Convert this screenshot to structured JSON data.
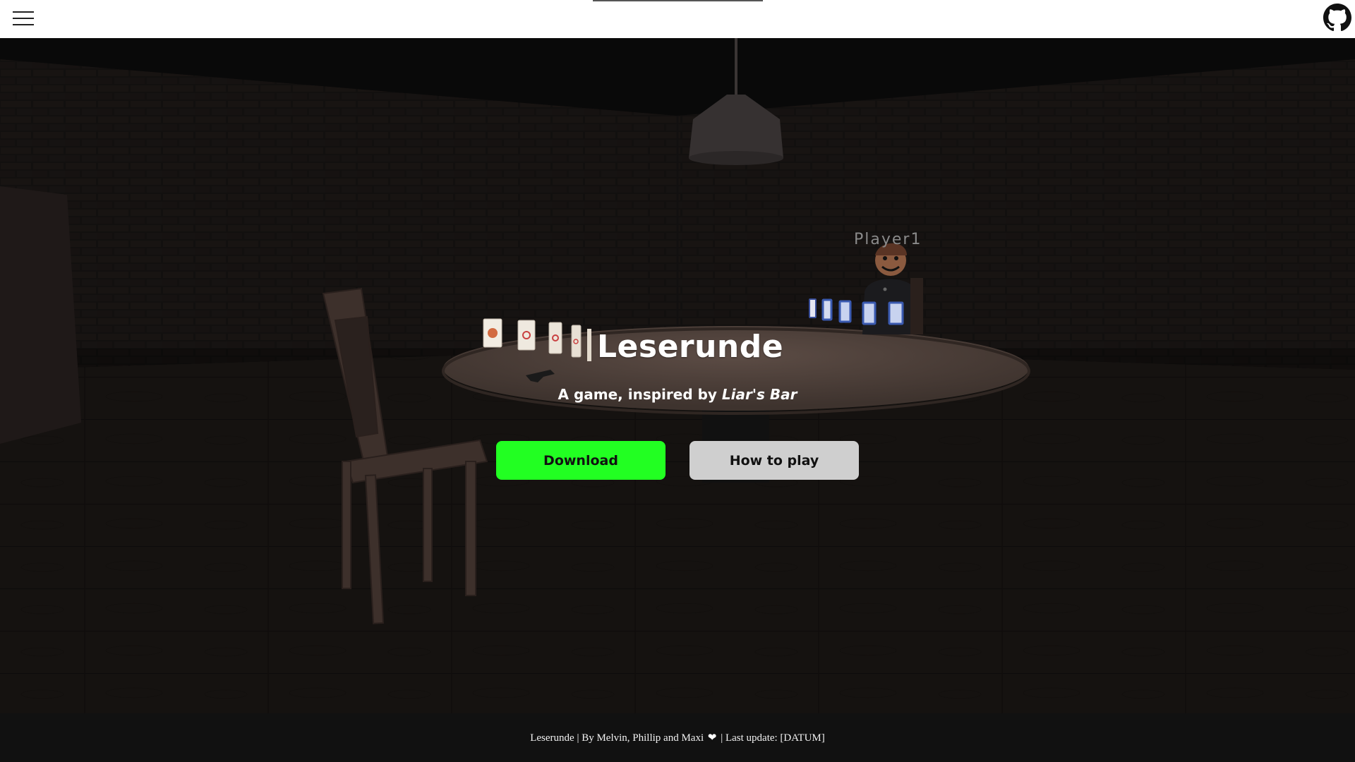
{
  "header": {
    "menu_icon": "hamburger-menu-icon",
    "github_icon": "github-icon"
  },
  "scene": {
    "player_label": "Player1"
  },
  "hero": {
    "title": "Leserunde",
    "subtitle_prefix": "A game, inspired by ",
    "subtitle_emphasis": "Liar's Bar",
    "download_label": "Download",
    "howto_label": "How to play"
  },
  "footer": {
    "text_before_heart": "Leserunde | By Melvin, Phillip and Maxi",
    "heart_icon": "heart-icon",
    "text_after_heart": "| Last update: [DATUM]"
  },
  "colors": {
    "download_bg": "#22ff22",
    "howto_bg": "#cfcfcf",
    "header_bg": "#ffffff",
    "footer_bg": "#111111"
  }
}
